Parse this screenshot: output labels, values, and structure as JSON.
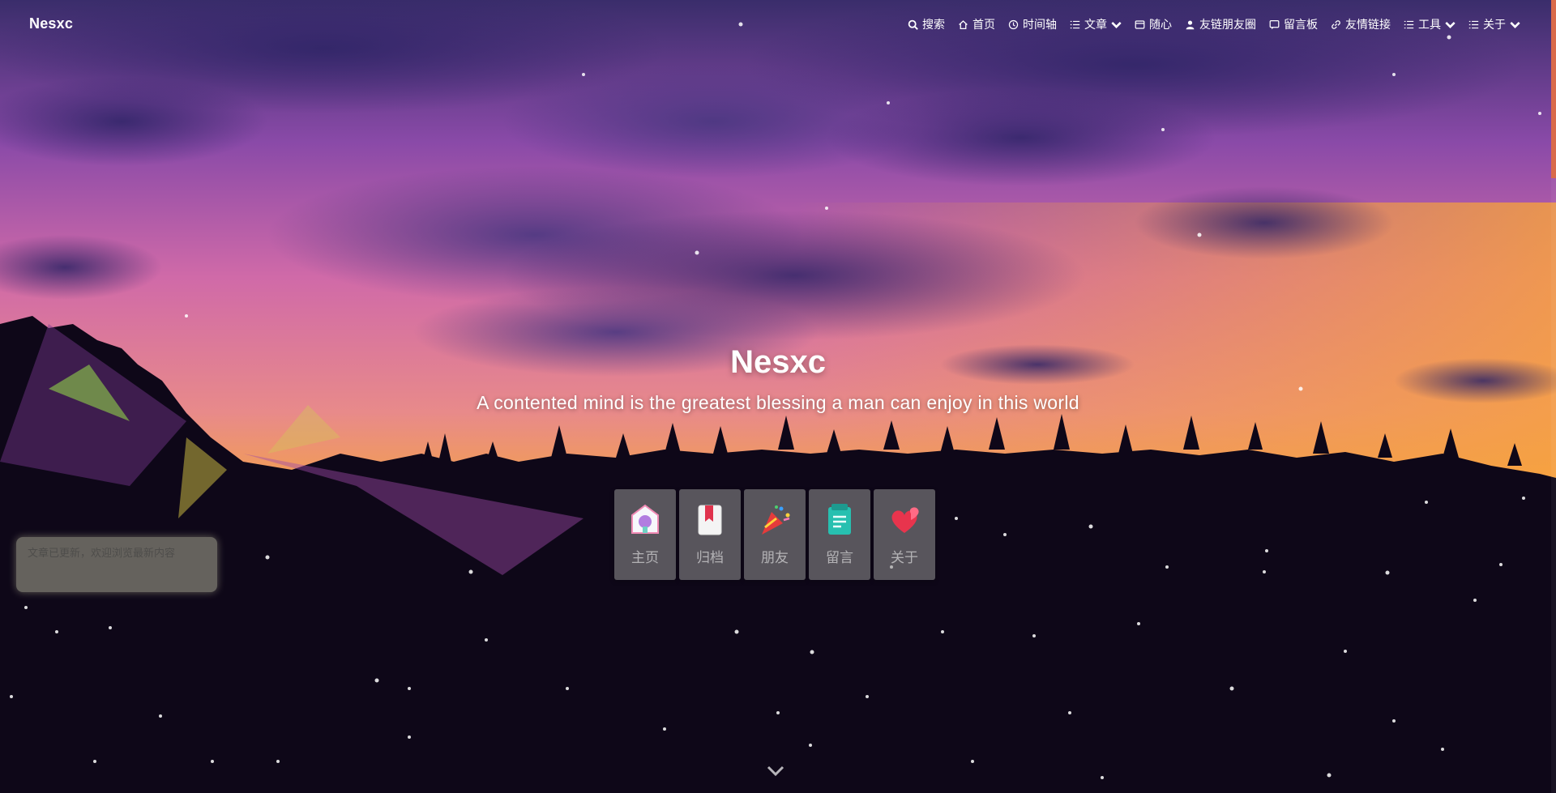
{
  "site": {
    "brand": "Nesxc"
  },
  "nav": {
    "items": [
      {
        "label": "搜索",
        "icon": "search-icon"
      },
      {
        "label": "首页",
        "icon": "home-icon"
      },
      {
        "label": "时间轴",
        "icon": "clock-icon"
      },
      {
        "label": "文章",
        "icon": "list-icon",
        "dropdown": true
      },
      {
        "label": "随心",
        "icon": "card-icon"
      },
      {
        "label": "友链朋友圈",
        "icon": "user-icon"
      },
      {
        "label": "留言板",
        "icon": "message-icon"
      },
      {
        "label": "友情链接",
        "icon": "link-icon"
      },
      {
        "label": "工具",
        "icon": "list-icon",
        "dropdown": true
      },
      {
        "label": "关于",
        "icon": "list-icon",
        "dropdown": true
      }
    ]
  },
  "hero": {
    "title": "Nesxc",
    "subtitle": "A contented mind is the greatest blessing a man can enjoy in this world"
  },
  "quick_links": [
    {
      "label": "主页",
      "icon": "home-badge-icon"
    },
    {
      "label": "归档",
      "icon": "bookmark-icon"
    },
    {
      "label": "朋友",
      "icon": "party-popper-icon"
    },
    {
      "label": "留言",
      "icon": "notes-icon"
    },
    {
      "label": "关于",
      "icon": "hearts-icon"
    }
  ],
  "toast": {
    "text": "文章已更新，欢迎浏览最新内容"
  },
  "colors": {
    "accent": "#d96a4a",
    "sky_top": "#3b2a6a",
    "sky_mid": "#c65ab0",
    "sunset": "#f0903a"
  }
}
